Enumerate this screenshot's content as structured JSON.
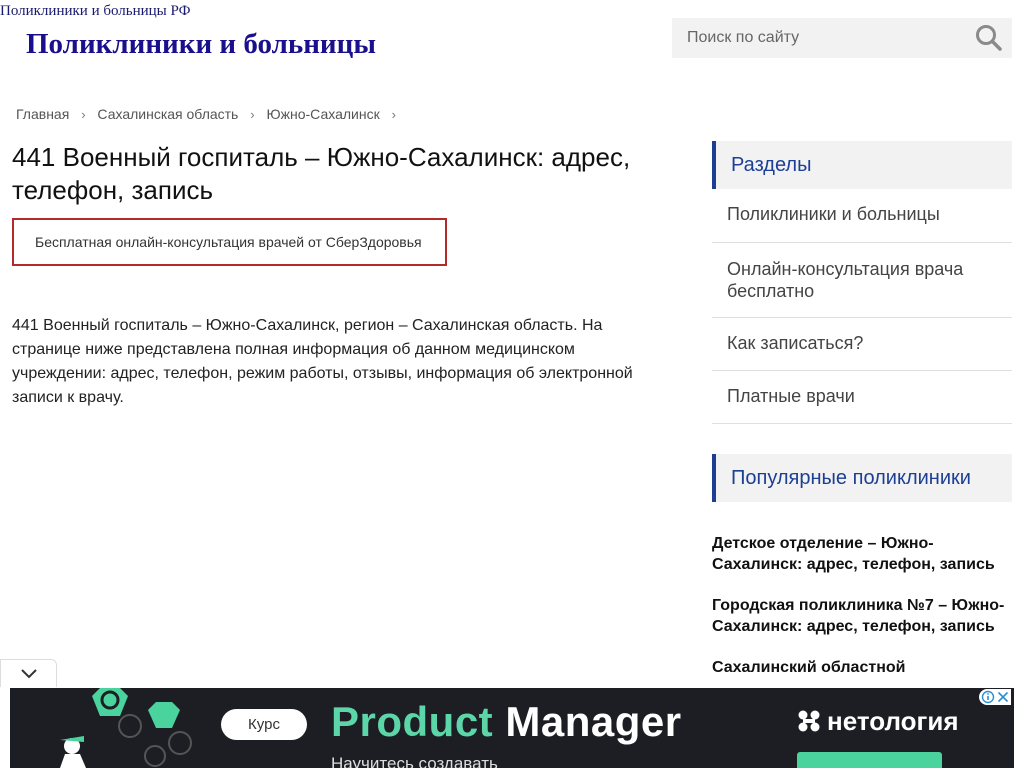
{
  "site": {
    "tagline": "Поликлиники и больницы РФ",
    "title": "Поликлиники и больницы"
  },
  "search": {
    "placeholder": "Поиск по сайту",
    "icon": "search-icon"
  },
  "breadcrumb": [
    "Главная",
    "Сахалинская область",
    "Южно-Сахалинск"
  ],
  "breadcrumb_separator": "›",
  "main": {
    "title": "441 Военный госпиталь – Южно-Сахалинск: адрес, телефон, запись",
    "consult_link": "Бесплатная онлайн-консультация врачей от СберЗдоровья",
    "intro": "441 Военный госпиталь – Южно-Сахалинск, регион – Сахалинская область. На странице ниже представлена полная информация об данном медицинском учреждении: адрес, телефон, режим работы, отзывы, информация об электронной записи к врачу."
  },
  "sidebar": {
    "sections_title": "Разделы",
    "sections": [
      "Поликлиники и больницы",
      "Онлайн-консультация врача бесплатно",
      "Как записаться?",
      "Платные врачи"
    ],
    "popular_title": "Популярные поликлиники",
    "popular": [
      "Детское отделение – Южно-Сахалинск: адрес, телефон, запись",
      "Городская поликлиника №7 – Южно-Сахалинск: адрес, телефон, запись",
      "Сахалинский областной"
    ]
  },
  "ad": {
    "pill": "Курс",
    "headline_1": "Product",
    "headline_2": "Manager",
    "subtext": "Научитесь создавать",
    "brand": "нетология"
  },
  "colors": {
    "title_blue": "#1a0f8c",
    "accent_blue": "#1c3f94",
    "consult_border": "#b22a2a",
    "ad_background": "#1d1d24",
    "ad_green": "#5cd6a8"
  }
}
